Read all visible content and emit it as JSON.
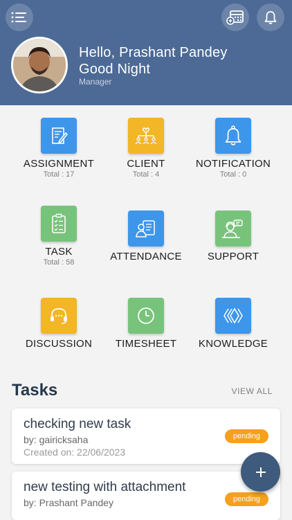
{
  "header": {
    "greeting": "Hello, Prashant Pandey",
    "time_greeting": "Good Night",
    "role": "Manager",
    "icons": [
      "menu-icon",
      "calendar-add-icon",
      "bell-icon"
    ]
  },
  "modules": [
    {
      "label": "ASSIGNMENT",
      "total": "Total : 17",
      "icon": "document-edit-icon",
      "color": "#3d96ea"
    },
    {
      "label": "CLIENT",
      "total": "Total : 4",
      "icon": "client-network-icon",
      "color": "#f2b626"
    },
    {
      "label": "NOTIFICATION",
      "total": "Total : 0",
      "icon": "bell-icon",
      "color": "#3d96ea"
    },
    {
      "label": "TASK",
      "total": "Total : 58",
      "icon": "clipboard-checklist-icon",
      "color": "#78c37b"
    },
    {
      "label": "ATTENDANCE",
      "icon": "id-card-icon",
      "color": "#3d96ea"
    },
    {
      "label": "SUPPORT",
      "icon": "support-agent-icon",
      "color": "#78c37b"
    },
    {
      "label": "DISCUSSION",
      "icon": "headset-icon",
      "color": "#f2b626"
    },
    {
      "label": "TIMESHEET",
      "icon": "clock-icon",
      "color": "#78c37b"
    },
    {
      "label": "KNOWLEDGE",
      "icon": "knowledge-chevrons-icon",
      "color": "#3d96ea"
    }
  ],
  "tasks_section": {
    "title": "Tasks",
    "view_all": "VIEW ALL",
    "items": [
      {
        "title": "checking new task",
        "by": "by: gairicksaha",
        "created": "Created on: 22/06/2023",
        "status": "pending"
      },
      {
        "title": "new testing with attachment",
        "by": "by: Prashant Pandey",
        "status": "pending"
      }
    ]
  },
  "fab": {
    "label": "+",
    "icon": "plus-icon"
  },
  "colors": {
    "header": "#4c6a95",
    "blue": "#3d96ea",
    "yellow": "#f2b626",
    "green": "#78c37b",
    "badge": "#f5a01f",
    "fab": "#3e5a7c"
  }
}
